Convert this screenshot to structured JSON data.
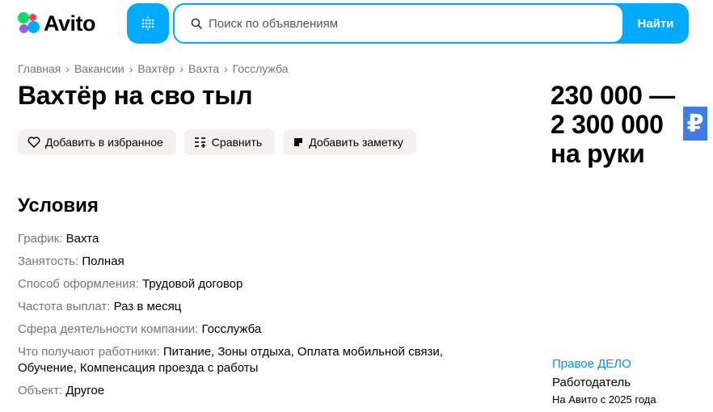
{
  "header": {
    "logo_text": "Avito",
    "search_placeholder": "Поиск по объявлениям",
    "search_button": "Найти",
    "accent_color": "#00aaff"
  },
  "breadcrumb": [
    "Главная",
    "Вакансии",
    "Вахтёр",
    "Вахта",
    "Госслужба"
  ],
  "listing": {
    "title": "Вахтёр на сво тыл",
    "price_line1": "230 000 —",
    "price_line2": "2 300 000",
    "price_line3": "на руки",
    "currency_symbol": "₽"
  },
  "actions": {
    "favorite": "Добавить в избранное",
    "compare": "Сравнить",
    "note": "Добавить заметку"
  },
  "conditions": {
    "title": "Условия",
    "items": [
      {
        "label": "График:",
        "value": "Вахта"
      },
      {
        "label": "Занятость:",
        "value": "Полная"
      },
      {
        "label": "Способ оформления:",
        "value": "Трудовой договор"
      },
      {
        "label": "Частота выплат:",
        "value": "Раз в месяц"
      },
      {
        "label": "Сфера деятельности компании:",
        "value": "Госслужба"
      },
      {
        "label": "Что получают работники:",
        "value": "Питание, Зоны отдыха, Оплата мобильной связи, Обучение, Компенсация проезда с работы"
      },
      {
        "label": "Объект:",
        "value": "Другое"
      }
    ]
  },
  "employer": {
    "name": "Правое ДЕЛО",
    "role": "Работодатель",
    "since": "На Авито с 2025 года"
  }
}
